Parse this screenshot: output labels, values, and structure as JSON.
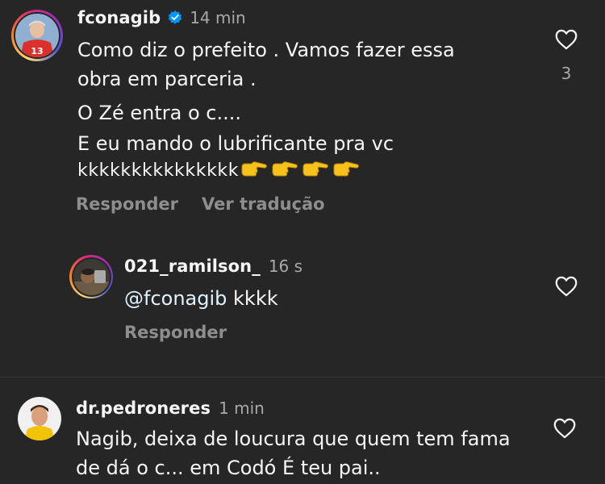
{
  "comments": [
    {
      "username": "fconagib",
      "verified": true,
      "time": "14 min",
      "lines": [
        "Como diz o prefeito . Vamos fazer essa",
        "obra em parceria .",
        "O Zé entra o c....",
        "E eu mando o lubrificante pra vc",
        "kkkkkkkkkkkkkkk"
      ],
      "emoji_count": 4,
      "emoji": "backhand-index-pointing-right",
      "reply_label": "Responder",
      "translate_label": "Ver tradução",
      "like_count": "3",
      "jersey_number": "13"
    },
    {
      "username": "021_ramilson_",
      "time": "16 s",
      "mention": "@fconagib",
      "text": " kkkk",
      "reply_label": "Responder"
    },
    {
      "username": "dr.pedroneres",
      "time": "1 min",
      "lines": [
        "Nagib, deixa de loucura que quem tem fama",
        "de dá o c... em Codó É teu pai.."
      ]
    }
  ],
  "colors": {
    "background": "#262626",
    "text": "#f5f5f5",
    "muted": "#a8a8a8",
    "verified": "#0095f6"
  }
}
